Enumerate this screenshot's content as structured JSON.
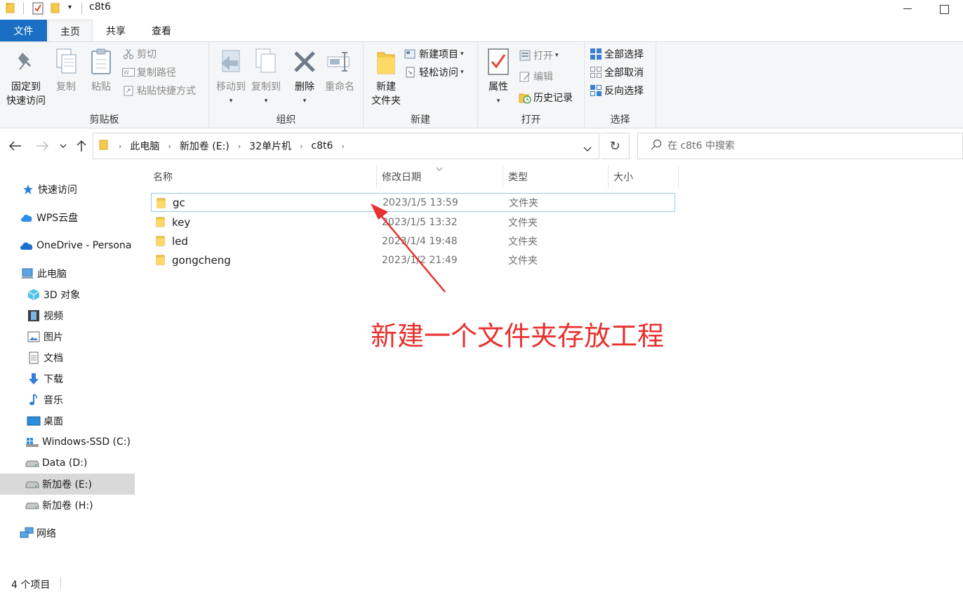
{
  "window": {
    "title": "c8t6",
    "quick_access_toolbar": [
      "folder-icon",
      "properties-check-icon",
      "new-folder-icon",
      "customize-dropdown-icon"
    ]
  },
  "ribbon_tabs": [
    {
      "label": "文件",
      "active": false
    },
    {
      "label": "主页",
      "active": true
    },
    {
      "label": "共享",
      "active": false
    },
    {
      "label": "查看",
      "active": false
    }
  ],
  "ribbon": {
    "clipboard": {
      "group_label": "剪贴板",
      "pin_label_1": "固定到",
      "pin_label_2": "快速访问",
      "copy_label": "复制",
      "paste_label": "粘贴",
      "cut_label": "剪切",
      "copy_path_label": "复制路径",
      "paste_shortcut_label": "粘贴快捷方式"
    },
    "organize": {
      "group_label": "组织",
      "move_to_label": "移动到",
      "copy_to_label": "复制到",
      "delete_label": "删除",
      "rename_label": "重命名"
    },
    "new": {
      "group_label": "新建",
      "new_folder_label_1": "新建",
      "new_folder_label_2": "文件夹",
      "new_item_label": "新建项目",
      "easy_access_label": "轻松访问"
    },
    "open": {
      "group_label": "打开",
      "properties_label": "属性",
      "open_label": "打开",
      "edit_label": "编辑",
      "history_label": "历史记录"
    },
    "select": {
      "group_label": "选择",
      "select_all_label": "全部选择",
      "select_none_label": "全部取消",
      "invert_label": "反向选择"
    }
  },
  "address": {
    "breadcrumbs": [
      "此电脑",
      "新加卷 (E:)",
      "32单片机",
      "c8t6"
    ],
    "search_placeholder": "在 c8t6 中搜索"
  },
  "nav_pane": {
    "items": [
      {
        "label": "快速访问",
        "icon": "star-icon"
      },
      {
        "label": "WPS云盘",
        "icon": "cloud-icon"
      },
      {
        "label": "OneDrive - Persona",
        "icon": "onedrive-icon"
      },
      {
        "label": "此电脑",
        "icon": "computer-icon"
      },
      {
        "label": "3D 对象",
        "icon": "cube-icon"
      },
      {
        "label": "视频",
        "icon": "film-icon"
      },
      {
        "label": "图片",
        "icon": "picture-icon"
      },
      {
        "label": "文档",
        "icon": "document-icon"
      },
      {
        "label": "下载",
        "icon": "download-arrow-icon"
      },
      {
        "label": "音乐",
        "icon": "music-note-icon"
      },
      {
        "label": "桌面",
        "icon": "desktop-icon"
      },
      {
        "label": "Windows-SSD (C:)",
        "icon": "windows-drive-icon"
      },
      {
        "label": "Data (D:)",
        "icon": "drive-icon"
      },
      {
        "label": "新加卷 (E:)",
        "icon": "drive-icon",
        "selected": true
      },
      {
        "label": "新加卷 (H:)",
        "icon": "drive-icon"
      },
      {
        "label": "网络",
        "icon": "network-icon"
      }
    ]
  },
  "file_list": {
    "columns": {
      "name": "名称",
      "modified": "修改日期",
      "type": "类型",
      "size": "大小"
    },
    "rows": [
      {
        "name": "gc",
        "modified": "2023/1/5 13:59",
        "type": "文件夹",
        "size": "",
        "selected": true
      },
      {
        "name": "key",
        "modified": "2023/1/5 13:32",
        "type": "文件夹",
        "size": ""
      },
      {
        "name": "led",
        "modified": "2023/1/4 19:48",
        "type": "文件夹",
        "size": ""
      },
      {
        "name": "gongcheng",
        "modified": "2023/1/2 21:49",
        "type": "文件夹",
        "size": ""
      }
    ]
  },
  "annotation": {
    "text": "新建一个文件夹存放工程",
    "color": "#e8312f"
  },
  "status": {
    "item_count": "4 个项目"
  },
  "colors": {
    "file_tab": "#1a6fc4",
    "ribbon_bg": "#f5f6f7",
    "selection_border": "#99c9ef",
    "nav_selected": "#d9d9d9",
    "folder_yellow": "#f6c94a"
  }
}
